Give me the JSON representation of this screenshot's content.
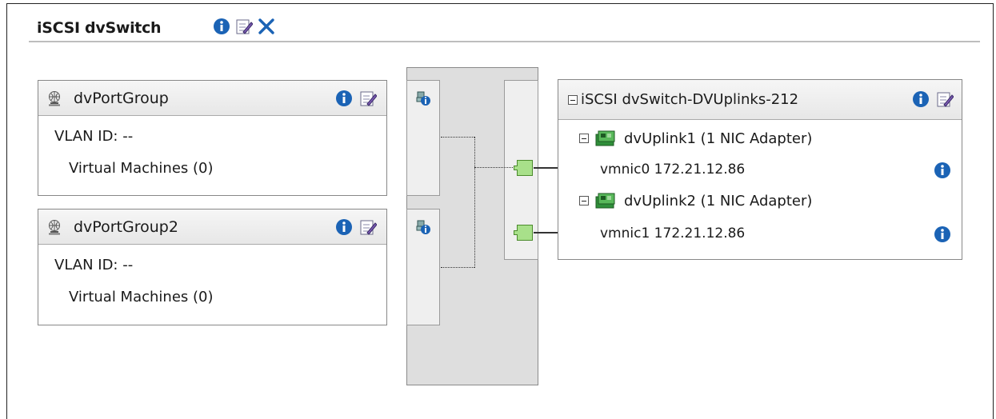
{
  "switch": {
    "title": "iSCSI dvSwitch",
    "icons": [
      "info-icon",
      "edit-icon",
      "delete-icon"
    ]
  },
  "port_groups": [
    {
      "name": "dvPortGroup",
      "vlan": "VLAN ID: --",
      "vms": "Virtual Machines (0)"
    },
    {
      "name": "dvPortGroup2",
      "vlan": "VLAN ID: --",
      "vms": "Virtual Machines (0)"
    }
  ],
  "uplinks": {
    "title": "iSCSI dvSwitch-DVUplinks-212",
    "items": [
      {
        "name": "dvUplink1 (1 NIC Adapter)",
        "nic": "vmnic0 172.21.12.86"
      },
      {
        "name": "dvUplink2 (1 NIC Adapter)",
        "nic": "vmnic1 172.21.12.86"
      }
    ]
  },
  "colors": {
    "info_blue": "#1b63b5",
    "port_green": "#a8e08a",
    "switch_gray": "#dedede"
  }
}
